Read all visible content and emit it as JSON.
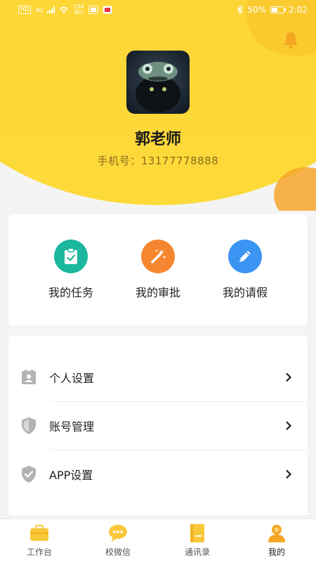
{
  "status_bar": {
    "network_badge": "HD",
    "network_type": "4G",
    "speed_value": "104",
    "speed_unit": "B/s",
    "battery_percent": "50%",
    "time": "2:02"
  },
  "profile": {
    "name": "郭老师",
    "phone_label": "手机号：",
    "phone_number": "13177778888"
  },
  "quick_actions": [
    {
      "label": "我的任务",
      "icon": "clipboard-check-icon",
      "color": "#1bb79f"
    },
    {
      "label": "我的审批",
      "icon": "magic-wand-icon",
      "color": "#f5862f"
    },
    {
      "label": "我的请假",
      "icon": "pencil-icon",
      "color": "#3d95f3"
    }
  ],
  "settings": [
    {
      "label": "个人设置",
      "icon": "id-card-icon"
    },
    {
      "label": "账号管理",
      "icon": "shield-icon"
    },
    {
      "label": "APP设置",
      "icon": "shield-check-icon"
    }
  ],
  "tabs": [
    {
      "label": "工作台",
      "icon": "briefcase-icon",
      "active": false
    },
    {
      "label": "校微信",
      "icon": "chat-bubble-icon",
      "active": false
    },
    {
      "label": "通讯录",
      "icon": "contacts-book-icon",
      "active": false
    },
    {
      "label": "我的",
      "icon": "person-icon",
      "active": true
    }
  ],
  "colors": {
    "header_yellow": "#fdd738",
    "accent_orange": "#f5a623",
    "teal": "#1bb79f",
    "orange": "#f5862f",
    "blue": "#3d95f3",
    "tab_icon_yellow": "#f9c73a"
  }
}
